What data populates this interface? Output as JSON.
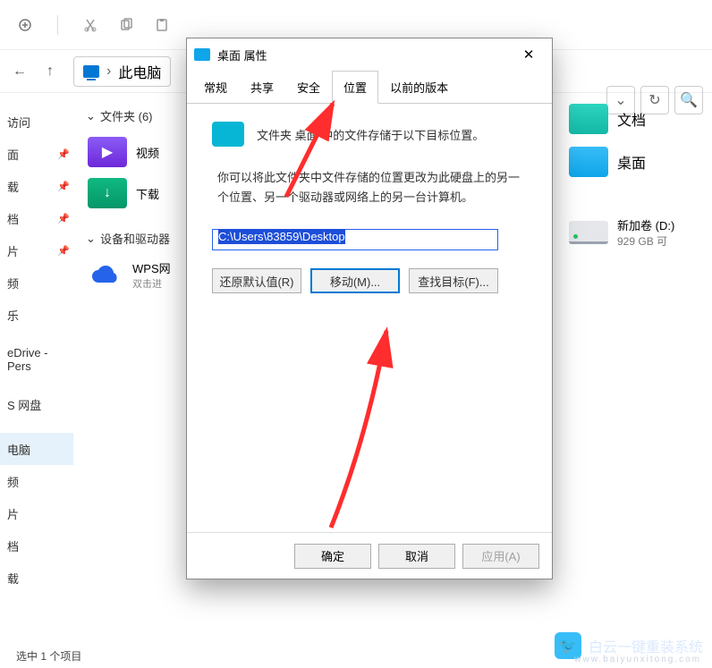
{
  "toolbar": {},
  "breadcrumb": {
    "label": "此电脑"
  },
  "sidebar": {
    "items": [
      {
        "label": "访问"
      },
      {
        "label": "面"
      },
      {
        "label": "载"
      },
      {
        "label": "档"
      },
      {
        "label": "片"
      },
      {
        "label": "频"
      },
      {
        "label": "乐"
      },
      {
        "label": ""
      },
      {
        "label": "eDrive - Pers"
      },
      {
        "label": ""
      },
      {
        "label": "S 网盘"
      },
      {
        "label": ""
      },
      {
        "label": "电脑"
      },
      {
        "label": "频"
      },
      {
        "label": "片"
      },
      {
        "label": "档"
      },
      {
        "label": "载"
      }
    ]
  },
  "content": {
    "group1": {
      "title": "文件夹 (6)"
    },
    "items": [
      {
        "label": "视频"
      },
      {
        "label": "下载"
      }
    ],
    "group2": {
      "title": "设备和驱动器"
    },
    "wps": {
      "label": "WPS网",
      "sub": "双击进"
    },
    "right": [
      {
        "label": "文档"
      },
      {
        "label": "桌面"
      }
    ],
    "drive": {
      "label": "新加卷 (D:)",
      "sub": "929 GB 可"
    }
  },
  "statusbar": {
    "text": "选中 1 个项目"
  },
  "dialog": {
    "title": "桌面 属性",
    "tabs": [
      {
        "label": "常规"
      },
      {
        "label": "共享"
      },
      {
        "label": "安全"
      },
      {
        "label": "位置"
      },
      {
        "label": "以前的版本"
      }
    ],
    "header": "文件夹 桌面 中的文件存储于以下目标位置。",
    "desc": "你可以将此文件夹中文件存储的位置更改为此硬盘上的另一个位置、另一个驱动器或网络上的另一台计算机。",
    "path": "C:\\Users\\83859\\Desktop",
    "buttons": {
      "restore": "还原默认值(R)",
      "move": "移动(M)...",
      "find": "查找目标(F)..."
    },
    "footer": {
      "ok": "确定",
      "cancel": "取消",
      "apply": "应用(A)"
    }
  },
  "watermark": {
    "text": "白云一键重装系统",
    "sub": "www.baiyunxitong.com"
  }
}
